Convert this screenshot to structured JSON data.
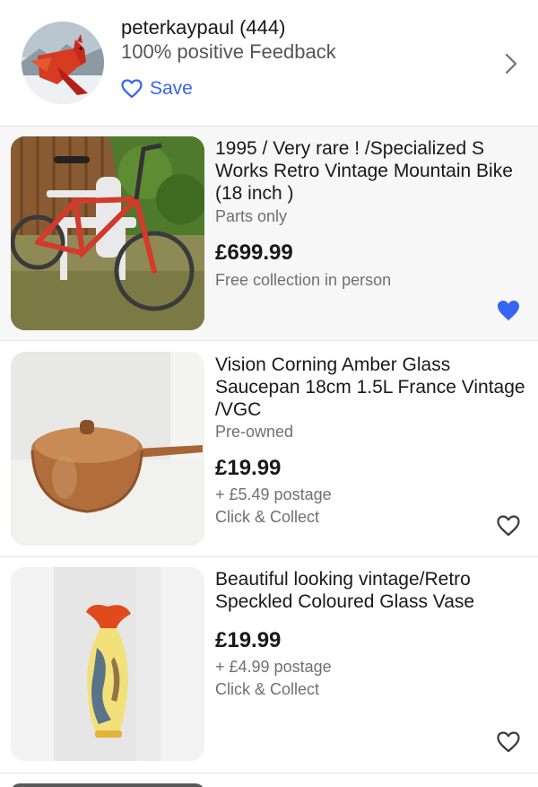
{
  "seller": {
    "name": "peterkaypaul (444)",
    "feedback": "100% positive Feedback",
    "save_label": "Save"
  },
  "items": [
    {
      "title": "1995 / Very rare ! /Specialized S Works  Retro Vintage Mountain Bike (18 inch )",
      "condition": "Parts only",
      "price": "£699.99",
      "shipping": "Free collection in person",
      "watched": true
    },
    {
      "title": "Vision Corning  Amber Glass Saucepan 18cm 1.5L France Vintage /VGC",
      "condition": "Pre-owned",
      "price": "£19.99",
      "shipping": "+ £5.49 postage",
      "pickup": "Click & Collect",
      "watched": false
    },
    {
      "title": "Beautiful looking vintage/Retro Speckled Coloured Glass Vase",
      "price": "£19.99",
      "shipping": "+ £4.99 postage",
      "pickup": "Click & Collect",
      "watched": false
    }
  ],
  "colors": {
    "accent": "#3665f3",
    "heart_filled": "#3665f3",
    "highlight_bg": "#f7f7f7"
  }
}
